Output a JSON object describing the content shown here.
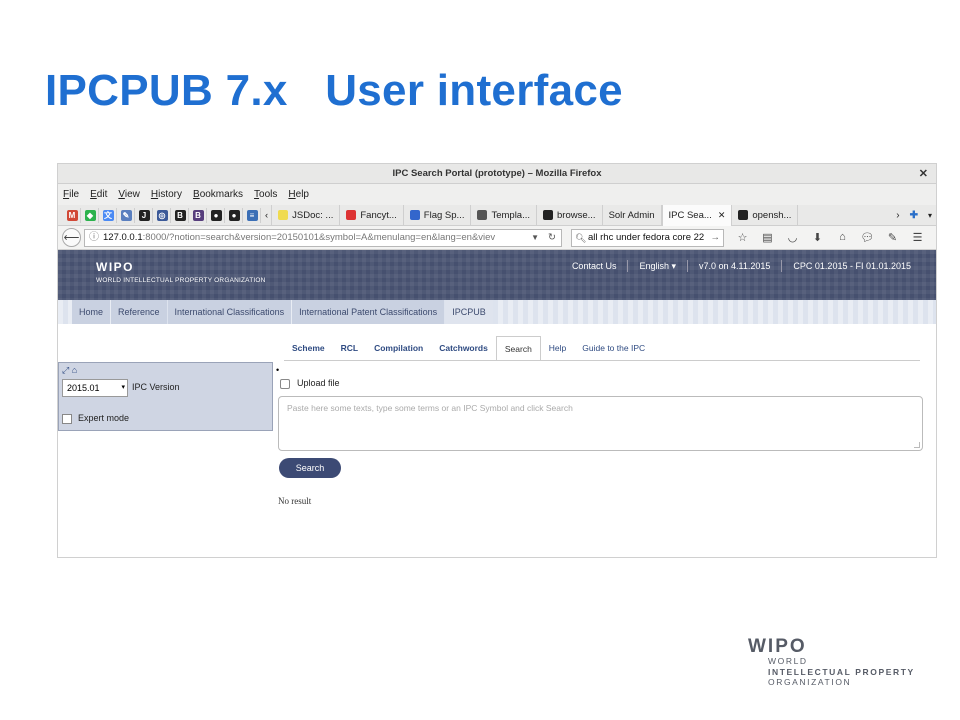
{
  "slide": {
    "title": "IPCPUB 7.x   User interface"
  },
  "window": {
    "title": "IPC Search Portal (prototype) – Mozilla Firefox",
    "close_icon": "close-icon"
  },
  "menu": [
    "File",
    "Edit",
    "View",
    "History",
    "Bookmarks",
    "Tools",
    "Help"
  ],
  "pinned_tabs": [
    {
      "icon": "gmail-icon",
      "glyph": "M",
      "color": "#d14836"
    },
    {
      "icon": "feedly-icon",
      "glyph": "◆",
      "color": "#2bb24c"
    },
    {
      "icon": "translate-icon",
      "glyph": "文",
      "color": "#4a8af4"
    },
    {
      "icon": "edit-icon",
      "glyph": "✎",
      "color": "#5a7fbf"
    },
    {
      "icon": "jsfiddle-icon",
      "glyph": "J",
      "color": "#222"
    },
    {
      "icon": "swirl-icon",
      "glyph": "◎",
      "color": "#3b5998"
    },
    {
      "icon": "bootstrap-icon",
      "glyph": "B",
      "color": "#222"
    },
    {
      "icon": "bootstrap-icon",
      "glyph": "B",
      "color": "#563d7c"
    },
    {
      "icon": "github-icon",
      "glyph": "●",
      "color": "#222"
    },
    {
      "icon": "github-icon",
      "glyph": "●",
      "color": "#222"
    },
    {
      "icon": "stack-icon",
      "glyph": "≡",
      "color": "#3b6fb6"
    }
  ],
  "tabs": [
    {
      "label": "JSDoc: ...",
      "icon": "jsdoc-icon",
      "color": "#f0db4f"
    },
    {
      "label": "Fancyt...",
      "icon": "fancytree-icon",
      "color": "#d33"
    },
    {
      "label": "Flag Sp...",
      "icon": "flag-icon",
      "color": "#3366cc"
    },
    {
      "label": "Templa...",
      "icon": "template-icon",
      "color": "#555"
    },
    {
      "label": "browse...",
      "icon": "github-icon",
      "color": "#222"
    },
    {
      "label": "Solr Admin",
      "icon": "",
      "color": ""
    },
    {
      "label": "IPC Sea...",
      "icon": "",
      "color": "",
      "active": true
    },
    {
      "label": "opensh...",
      "icon": "github-icon",
      "color": "#222"
    }
  ],
  "nav": {
    "url_host": "127.0.0.1",
    "url_rest": ":8000/?notion=search&version=20150101&symbol=A&menulang=en&lang=en&viev",
    "search_text": "all rhc under fedora core 22"
  },
  "wipo": {
    "logo_big": "WIPO",
    "logo_small": "WORLD INTELLECTUAL PROPERTY ORGANIZATION",
    "links": [
      "Contact Us",
      "English ▾",
      "v7.0 on 4.11.2015",
      "CPC 01.2015 - FI 01.01.2015"
    ]
  },
  "breadcrumbs": [
    "Home",
    "Reference",
    "International Classifications",
    "International Patent Classifications",
    "IPCPUB"
  ],
  "subtabs": [
    "Scheme",
    "RCL",
    "Compilation",
    "Catchwords",
    "Search",
    "Help",
    "Guide to the IPC"
  ],
  "panel": {
    "version_value": "2015.01",
    "version_label": "IPC Version",
    "expert_label": "Expert mode"
  },
  "search": {
    "bullet": "•",
    "upload_label": "Upload file",
    "placeholder": "Paste here some texts, type some terms or an IPC Symbol and click Search",
    "button": "Search",
    "result": "No result"
  },
  "footer_logo": {
    "big": "WIPO",
    "line1": "WORLD",
    "line2": "INTELLECTUAL PROPERTY",
    "line3": "ORGANIZATION"
  }
}
